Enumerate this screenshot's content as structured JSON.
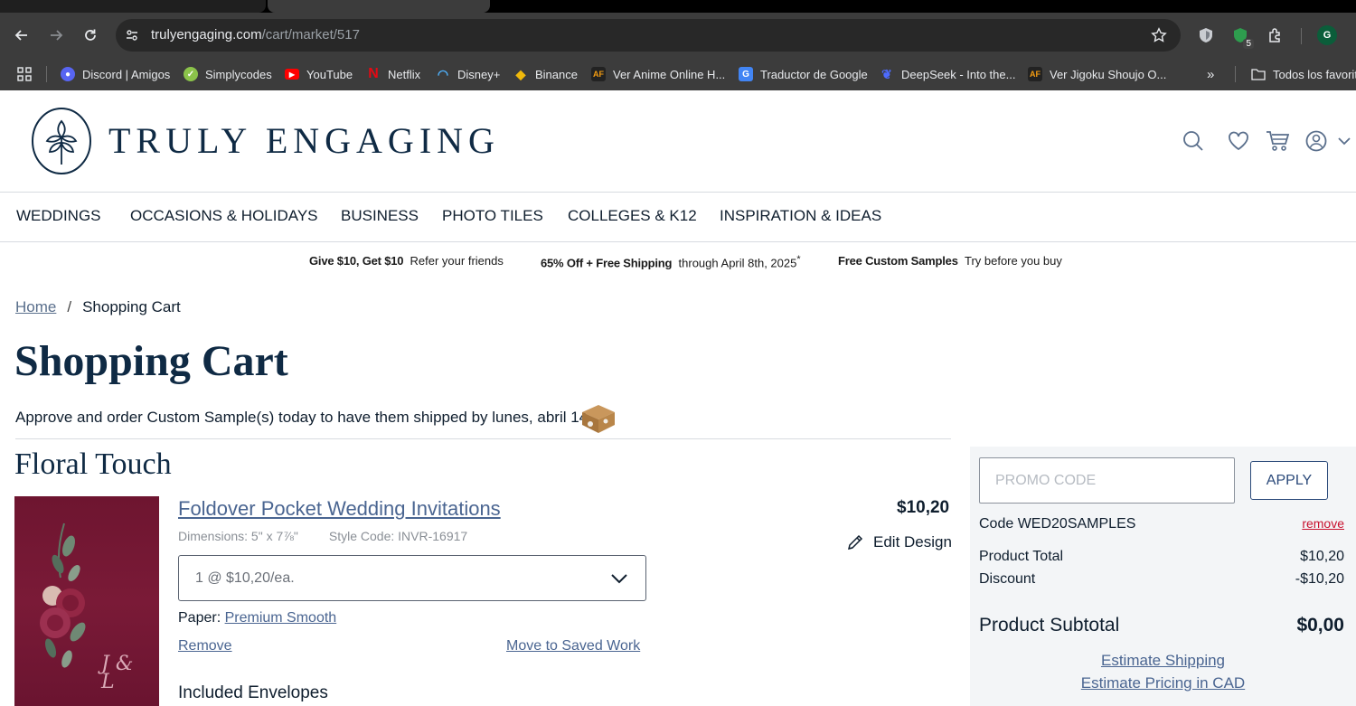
{
  "browser": {
    "url_host": "trulyengaging.com",
    "url_path": "/cart/market/517",
    "extension_badge": "5",
    "profile_initial": "G"
  },
  "bookmarks": [
    {
      "label": "Discord | Amigos",
      "icon": "discord-icon",
      "color": "#5865f2"
    },
    {
      "label": "Simplycodes",
      "icon": "simplycodes-icon",
      "color": "#8bc34a"
    },
    {
      "label": "YouTube",
      "icon": "youtube-icon",
      "color": "#ff0000"
    },
    {
      "label": "Netflix",
      "icon": "netflix-icon",
      "color": "#e50914"
    },
    {
      "label": "Disney+",
      "icon": "disney-icon",
      "color": "#1a3f8a"
    },
    {
      "label": "Binance",
      "icon": "binance-icon",
      "color": "#f0b90b"
    },
    {
      "label": "Ver Anime Online H...",
      "icon": "animeflv-icon",
      "color": "#333333"
    },
    {
      "label": "Traductor de Google",
      "icon": "google-translate-icon",
      "color": "#4285f4"
    },
    {
      "label": "DeepSeek - Into the...",
      "icon": "deepseek-icon",
      "color": "#4d6bfe"
    },
    {
      "label": "Ver Jigoku Shoujo O...",
      "icon": "animeflv-icon",
      "color": "#333333"
    }
  ],
  "bookmarks_overflow": "»",
  "bookmarks_folder": "Todos los favoritos",
  "site": {
    "logo_text": "TRULY ENGAGING",
    "nav": [
      "WEDDINGS",
      "OCCASIONS & HOLIDAYS",
      "BUSINESS",
      "PHOTO TILES",
      "COLLEGES & K12",
      "INSPIRATION & IDEAS"
    ]
  },
  "promos": [
    {
      "bold": "Give $10, Get $10",
      "text": "Refer your friends"
    },
    {
      "bold": "65% Off + Free Shipping",
      "text": "through April 8th, 2025",
      "sup": "*"
    },
    {
      "bold": "Free Custom Samples",
      "text": "Try before you buy"
    }
  ],
  "breadcrumb": {
    "home": "Home",
    "current": "Shopping Cart"
  },
  "page_title": "Shopping Cart",
  "sample_note": "Approve and order Custom Sample(s) today to have them shipped by lunes, abril 14",
  "cart": {
    "group_title": "Floral Touch",
    "product_name": "Foldover Pocket Wedding Invitations",
    "dimensions": "Dimensions: 5\" x 7⅞\"",
    "style_code": "Style Code: INVR-16917",
    "price": "$10,20",
    "edit_label": "Edit Design",
    "quantity": "1 @ $10,20/ea.",
    "paper_label": "Paper:",
    "paper_value": "Premium Smooth",
    "remove_label": "Remove",
    "move_label": "Move to Saved Work",
    "envelopes_title": "Included Envelopes",
    "thumb_monogram": "J & L"
  },
  "summary": {
    "promo_placeholder": "PROMO CODE",
    "apply_label": "APPLY",
    "code_label": "Code WED20SAMPLES",
    "code_remove": "remove",
    "product_total_label": "Product Total",
    "product_total_value": "$10,20",
    "discount_label": "Discount",
    "discount_value": "-$10,20",
    "subtotal_label": "Product Subtotal",
    "subtotal_value": "$0,00",
    "estimate_shipping": "Estimate Shipping",
    "estimate_cad": "Estimate Pricing in CAD"
  }
}
